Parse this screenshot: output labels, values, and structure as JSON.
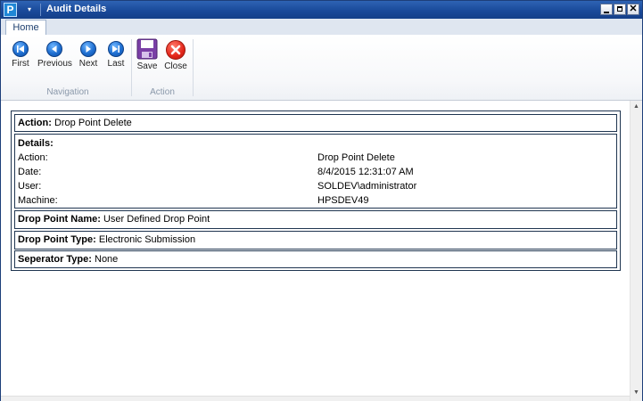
{
  "window": {
    "title": "Audit Details",
    "app_icon_letter": "P",
    "qat_glyph": "▾",
    "controls": {
      "minimize": "",
      "maximize": "",
      "close": "✕"
    }
  },
  "ribbon": {
    "tabs": [
      {
        "label": "Home",
        "active": true
      }
    ],
    "groups": {
      "navigation": {
        "label": "Navigation",
        "buttons": {
          "first": "First",
          "previous": "Previous",
          "next": "Next",
          "last": "Last"
        }
      },
      "action": {
        "label": "Action",
        "buttons": {
          "save": "Save",
          "close": "Close"
        }
      }
    }
  },
  "report": {
    "action": {
      "key": "Action:",
      "value": "Drop Point Delete"
    },
    "details": {
      "heading": "Details:",
      "rows": [
        {
          "label": "Action:",
          "value": "Drop Point Delete"
        },
        {
          "label": "Date:",
          "value": "8/4/2015 12:31:07 AM"
        },
        {
          "label": "User:",
          "value": "SOLDEV\\administrator"
        },
        {
          "label": "Machine:",
          "value": "HPSDEV49"
        }
      ]
    },
    "drop_point_name": {
      "key": "Drop Point Name:",
      "value": "User Defined Drop Point"
    },
    "drop_point_type": {
      "key": "Drop Point Type:",
      "value": "Electronic Submission"
    },
    "separator_type": {
      "key": "Seperator Type:",
      "value": "None"
    }
  },
  "colors": {
    "titlebar": "#1a4a9a",
    "nav_button": "#1f6fd1",
    "close_button": "#e3261a",
    "save_icon": "#7a3fa6",
    "border": "#1f3550"
  },
  "icons": {
    "first": "skip-first-icon",
    "previous": "previous-icon",
    "next": "next-icon",
    "last": "skip-last-icon",
    "save": "floppy-disk-icon",
    "close": "close-x-icon"
  }
}
